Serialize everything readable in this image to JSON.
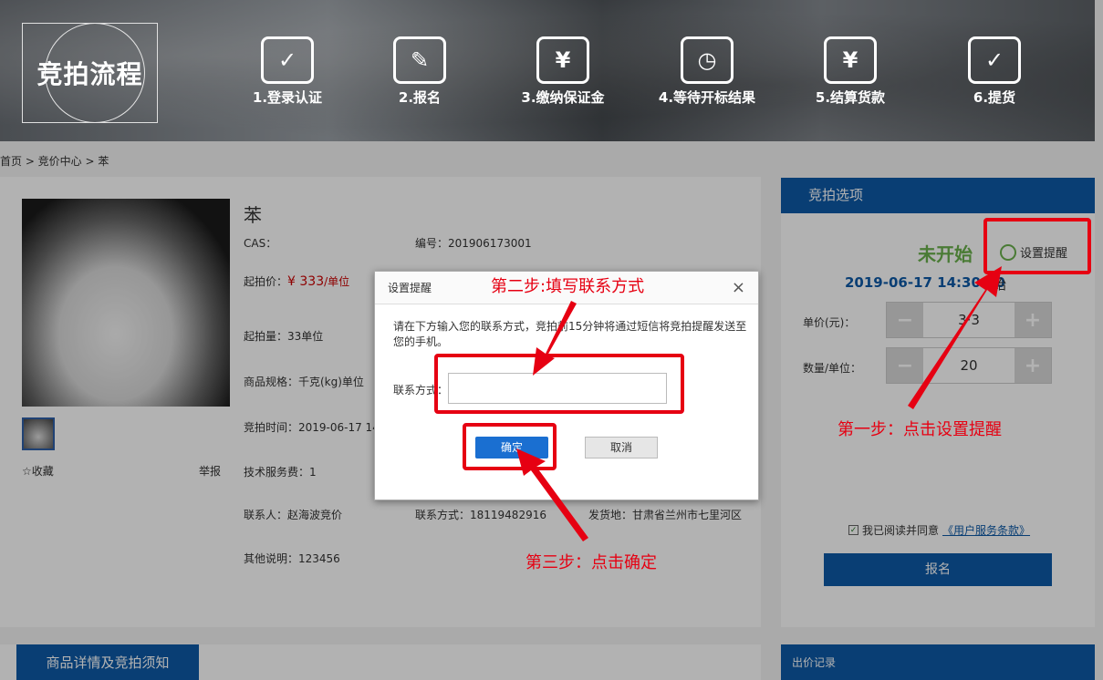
{
  "banner": {
    "flow_title": "竞拍流程",
    "steps": [
      "1.登录认证",
      "2.报名",
      "3.缴纳保证金",
      "4.等待开标结果",
      "5.结算货款",
      "6.提货"
    ],
    "step_icons": [
      "user-check-icon",
      "form-pen-icon",
      "card-yuan-icon",
      "calendar-clock-icon",
      "clipboard-yuan-icon",
      "bag-check-icon"
    ]
  },
  "breadcrumb": "首页 > 竞价中心 > 苯",
  "product": {
    "name": "苯",
    "cas": "CAS：",
    "code": "编号：201906173001",
    "start_price_label": "起拍价：",
    "start_price": "¥ 333",
    "start_price_unit": "/单位",
    "start_qty": "起拍量：33单位",
    "spec": "商品规格：千克(kg)单位",
    "auction_time": "竞拍时间：2019-06-17 14",
    "service_fee": "技术服务费：1",
    "contact_person": "联系人：赵海波竞价",
    "contact_phone": "联系方式：18119482916",
    "ship_from": "发货地：甘肃省兰州市七里河区",
    "remarks": "其他说明：123456",
    "collect": "收藏",
    "report": "举报"
  },
  "side": {
    "header": "竞拍选项",
    "status": "未开始",
    "remind": "设置提醒",
    "datetime": "2019-06-17 14:30:00",
    "datetime_suffix": "始",
    "unit_price_label": "单价(元)：",
    "unit_price_value": "3·3",
    "qty_label": "数量/单位：",
    "qty_value": "20",
    "minus": "−",
    "plus": "+",
    "agree_text": "我已阅读并同意",
    "agree_link": "《用户服务条款》",
    "signup": "报名"
  },
  "bottom": {
    "detail_tab": "商品详情及竞拍须知",
    "bid_tab": "出价记录"
  },
  "dialog": {
    "title": "设置提醒",
    "close": "×",
    "message": "请在下方输入您的联系方式，竞拍前15分钟将通过短信将竞拍提醒发送至您的手机。",
    "field_label": "联系方式：",
    "field_value": "",
    "ok": "确定",
    "cancel": "取消"
  },
  "annotations": {
    "step1": "第一步：点击设置提醒",
    "step2": "第二步:填写联系方式",
    "step3": "第三步：点击确定",
    "color": "#e60012"
  }
}
